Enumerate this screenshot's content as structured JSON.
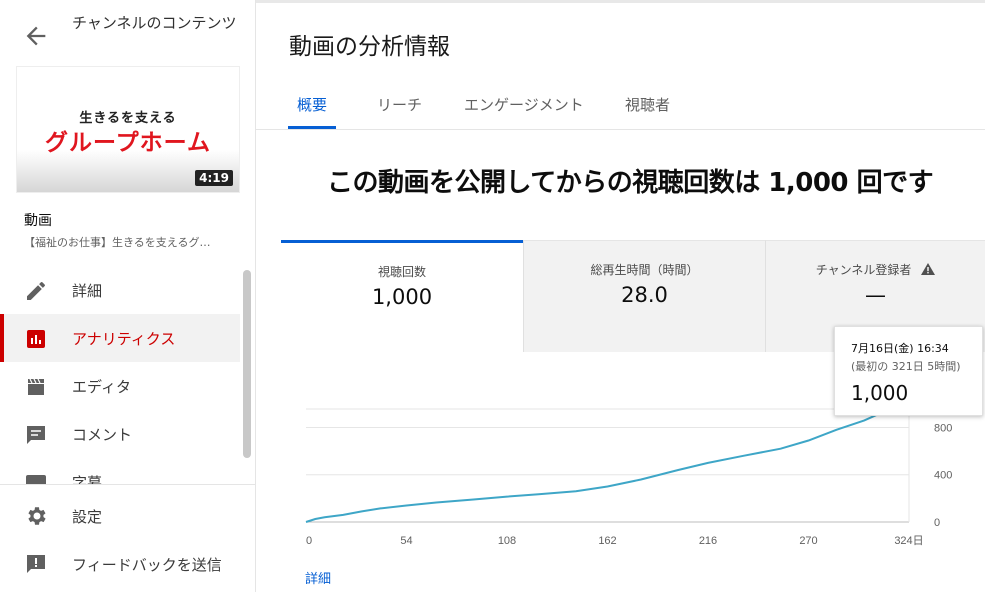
{
  "sidebar": {
    "back_icon": "arrow-left-icon",
    "title": "チャンネルのコンテンツ",
    "thumbnail": {
      "line1": "生きるを支える",
      "line2": "グループホーム",
      "duration": "4:19"
    },
    "video_label": "動画",
    "video_title": "【福祉のお仕事】生きるを支えるグ…",
    "items": [
      {
        "label": "詳細",
        "icon": "pencil-icon",
        "active": false
      },
      {
        "label": "アナリティクス",
        "icon": "analytics-icon",
        "active": true
      },
      {
        "label": "エディタ",
        "icon": "clapperboard-icon",
        "active": false
      },
      {
        "label": "コメント",
        "icon": "comment-icon",
        "active": false
      },
      {
        "label": "字幕",
        "icon": "subtitles-icon",
        "active": false
      }
    ],
    "bottom": [
      {
        "label": "設定",
        "icon": "gear-icon"
      },
      {
        "label": "フィードバックを送信",
        "icon": "feedback-icon"
      }
    ]
  },
  "main": {
    "title": "動画の分析情報",
    "tabs": [
      {
        "label": "概要",
        "active": true
      },
      {
        "label": "リーチ",
        "active": false
      },
      {
        "label": "エンゲージメント",
        "active": false
      },
      {
        "label": "視聴者",
        "active": false
      }
    ],
    "headline": "この動画を公開してからの視聴回数は 1,000 回です",
    "metrics": [
      {
        "label": "視聴回数",
        "value": "1,000",
        "active": true
      },
      {
        "label": "総再生時間（時間）",
        "value": "28.0",
        "active": false
      },
      {
        "label": "チャンネル登録者",
        "value": "—",
        "active": false,
        "warning_icon": "warning-icon"
      }
    ],
    "tooltip": {
      "date": "7月16日(金) 16:34",
      "sub": "(最初の 321日 5時間)",
      "value": "1,000"
    },
    "details_link": "詳細"
  },
  "chart_data": {
    "type": "line",
    "title": "",
    "xlabel": "",
    "ylabel": "",
    "x_ticks": [
      "0",
      "54",
      "108",
      "162",
      "216",
      "270",
      "324日"
    ],
    "y_ticks": [
      "0",
      "400",
      "800"
    ],
    "xlim": [
      0,
      324
    ],
    "ylim": [
      0,
      1100
    ],
    "grid": true,
    "color": "#3ea6c7",
    "series": [
      {
        "x": [
          0,
          5,
          10,
          20,
          30,
          40,
          54,
          70,
          90,
          108,
          125,
          145,
          162,
          180,
          200,
          216,
          235,
          255,
          270,
          285,
          300,
          310,
          316,
          321
        ],
        "values": [
          0,
          25,
          40,
          60,
          90,
          115,
          140,
          165,
          190,
          215,
          235,
          260,
          300,
          360,
          440,
          500,
          560,
          620,
          690,
          780,
          860,
          930,
          990,
          1000
        ]
      }
    ],
    "highlight": {
      "x": 321,
      "y": 1000
    }
  }
}
